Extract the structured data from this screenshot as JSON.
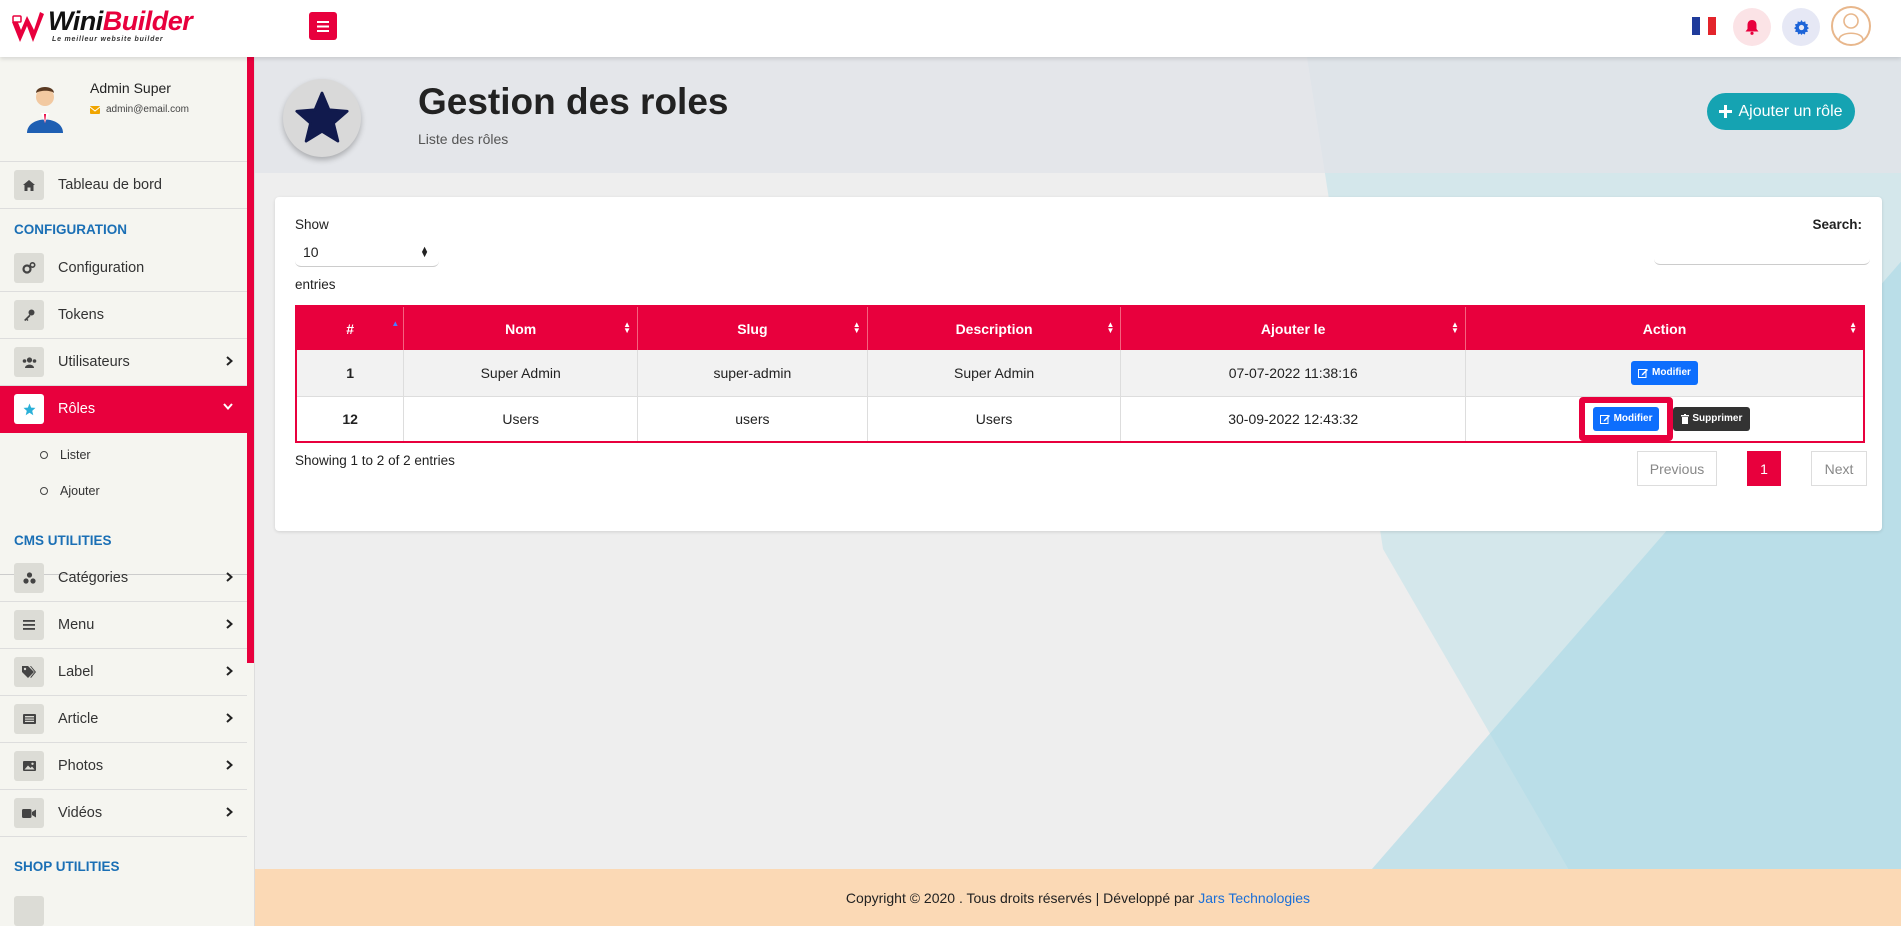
{
  "brand": {
    "name_a": "Wini",
    "name_b": "Builder",
    "tagline": "Le meilleur website builder"
  },
  "user": {
    "name": "Admin Super",
    "email": "admin@email.com"
  },
  "sidebar": {
    "dashboard": "Tableau de bord",
    "section_config": "CONFIGURATION",
    "configuration": "Configuration",
    "tokens": "Tokens",
    "users": "Utilisateurs",
    "roles": "Rôles",
    "roles_list": "Lister",
    "roles_add": "Ajouter",
    "section_cms": "CMS UTILITIES",
    "categories": "Catégories",
    "menu": "Menu",
    "label": "Label",
    "article": "Article",
    "photos": "Photos",
    "videos": "Vidéos",
    "section_shop": "SHOP UTILITIES"
  },
  "page": {
    "title": "Gestion des roles",
    "subtitle": "Liste des rôles",
    "add_button": "Ajouter un rôle"
  },
  "table_controls": {
    "show": "Show",
    "length_value": "10",
    "entries": "entries",
    "search": "Search:",
    "info": "Showing 1 to 2 of 2 entries",
    "previous": "Previous",
    "current_page": "1",
    "next": "Next"
  },
  "table": {
    "headers": [
      "#",
      "Nom",
      "Slug",
      "Description",
      "Ajouter le",
      "Action"
    ],
    "rows": [
      {
        "id": "1",
        "nom": "Super Admin",
        "slug": "super-admin",
        "description": "Super Admin",
        "date": "07-07-2022 11:38:16"
      },
      {
        "id": "12",
        "nom": "Users",
        "slug": "users",
        "description": "Users",
        "date": "30-09-2022 12:43:32"
      }
    ],
    "edit_label": "Modifier",
    "delete_label": "Supprimer"
  },
  "footer": {
    "text": "Copyright © 2020 . Tous droits réservés | Développé par",
    "link": "Jars Technologies"
  },
  "colors": {
    "primary": "#e8003d",
    "accent": "#15a3b2",
    "link": "#1a6fb5",
    "edit": "#0d6efd"
  },
  "icons": [
    "menu-icon",
    "bell-icon",
    "gear-icon",
    "home-icon",
    "cogs-icon",
    "key-icon",
    "users-icon",
    "star-icon",
    "chevron-right-icon",
    "chevron-down-icon",
    "plus-icon",
    "edit-icon",
    "trash-icon",
    "sort-icon"
  ]
}
